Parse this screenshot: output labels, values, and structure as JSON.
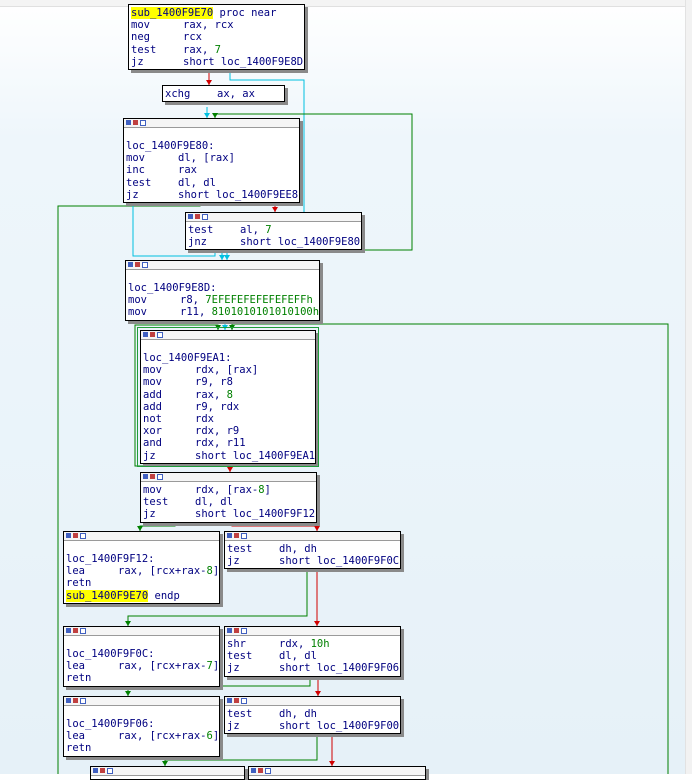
{
  "nodes": [
    {
      "id": "n0",
      "header": false,
      "selected": false,
      "lines": [
        {
          "kind": "label",
          "text": "sub_1400F9E70",
          "suffix": " proc near",
          "highlight": true
        },
        {
          "kind": "ins",
          "m": "mov",
          "o": "rax, rcx"
        },
        {
          "kind": "ins",
          "m": "neg",
          "o": "rcx"
        },
        {
          "kind": "ins",
          "m": "test",
          "o": "rax, ",
          "n": "7"
        },
        {
          "kind": "ins",
          "m": "jz",
          "o": "short loc_1400F9E8D"
        }
      ]
    },
    {
      "id": "n1",
      "header": false,
      "selected": false,
      "lines": [
        {
          "kind": "ins",
          "m": "xchg",
          "o": "ax, ax"
        }
      ]
    },
    {
      "id": "n2",
      "header": true,
      "selected": false,
      "lines": [
        {
          "kind": "blank"
        },
        {
          "kind": "label",
          "text": "loc_1400F9E80:"
        },
        {
          "kind": "ins",
          "m": "mov",
          "o": "dl, [rax]"
        },
        {
          "kind": "ins",
          "m": "inc",
          "o": "rax"
        },
        {
          "kind": "ins",
          "m": "test",
          "o": "dl, dl"
        },
        {
          "kind": "ins",
          "m": "jz",
          "o": "short loc_1400F9EE8"
        }
      ]
    },
    {
      "id": "n3",
      "header": true,
      "selected": false,
      "lines": [
        {
          "kind": "ins",
          "m": "test",
          "o": "al, ",
          "n": "7"
        },
        {
          "kind": "ins",
          "m": "jnz",
          "o": "short loc_1400F9E80"
        }
      ]
    },
    {
      "id": "n4",
      "header": true,
      "selected": false,
      "lines": [
        {
          "kind": "blank"
        },
        {
          "kind": "label",
          "text": "loc_1400F9E8D:"
        },
        {
          "kind": "ins",
          "m": "mov",
          "o": "r8, ",
          "n": "7EFEFEFEFEFEFEFFh"
        },
        {
          "kind": "ins",
          "m": "mov",
          "o": "r11, ",
          "n": "8101010101010100h"
        }
      ]
    },
    {
      "id": "n5",
      "header": true,
      "selected": true,
      "lines": [
        {
          "kind": "blank"
        },
        {
          "kind": "label",
          "text": "loc_1400F9EA1:"
        },
        {
          "kind": "ins",
          "m": "mov",
          "o": "rdx, [rax]"
        },
        {
          "kind": "ins",
          "m": "mov",
          "o": "r9, r8"
        },
        {
          "kind": "ins",
          "m": "add",
          "o": "rax, ",
          "n": "8"
        },
        {
          "kind": "ins",
          "m": "add",
          "o": "r9, rdx"
        },
        {
          "kind": "ins",
          "m": "not",
          "o": "rdx"
        },
        {
          "kind": "ins",
          "m": "xor",
          "o": "rdx, r9"
        },
        {
          "kind": "ins",
          "m": "and",
          "o": "rdx, r11"
        },
        {
          "kind": "ins",
          "m": "jz",
          "o": "short loc_1400F9EA1"
        }
      ]
    },
    {
      "id": "n6",
      "header": true,
      "selected": false,
      "lines": [
        {
          "kind": "ins",
          "m": "mov",
          "o": "rdx, [rax-",
          "n": "8",
          "o2": "]"
        },
        {
          "kind": "ins",
          "m": "test",
          "o": "dl, dl"
        },
        {
          "kind": "ins",
          "m": "jz",
          "o": "short loc_1400F9F12"
        }
      ]
    },
    {
      "id": "n7",
      "header": true,
      "selected": false,
      "lines": [
        {
          "kind": "blank"
        },
        {
          "kind": "label",
          "text": "loc_1400F9F12:"
        },
        {
          "kind": "ins",
          "m": "lea",
          "o": "rax, [rcx+rax-",
          "n": "8",
          "o2": "]"
        },
        {
          "kind": "ins",
          "m": "retn",
          "o": ""
        },
        {
          "kind": "label",
          "text": "sub_1400F9E70",
          "suffix": " endp",
          "highlight": true
        }
      ]
    },
    {
      "id": "n8",
      "header": true,
      "selected": false,
      "lines": [
        {
          "kind": "ins",
          "m": "test",
          "o": "dh, dh"
        },
        {
          "kind": "ins",
          "m": "jz",
          "o": "short loc_1400F9F0C"
        }
      ]
    },
    {
      "id": "n9",
      "header": true,
      "selected": false,
      "lines": [
        {
          "kind": "blank"
        },
        {
          "kind": "label",
          "text": "loc_1400F9F0C:"
        },
        {
          "kind": "ins",
          "m": "lea",
          "o": "rax, [rcx+rax-",
          "n": "7",
          "o2": "]"
        },
        {
          "kind": "ins",
          "m": "retn",
          "o": ""
        }
      ]
    },
    {
      "id": "n10",
      "header": true,
      "selected": false,
      "lines": [
        {
          "kind": "ins",
          "m": "shr",
          "o": "rdx, ",
          "n": "10h"
        },
        {
          "kind": "ins",
          "m": "test",
          "o": "dl, dl"
        },
        {
          "kind": "ins",
          "m": "jz",
          "o": "short loc_1400F9F06"
        }
      ]
    },
    {
      "id": "n11",
      "header": true,
      "selected": false,
      "lines": [
        {
          "kind": "blank"
        },
        {
          "kind": "label",
          "text": "loc_1400F9F06:"
        },
        {
          "kind": "ins",
          "m": "lea",
          "o": "rax, [rcx+rax-",
          "n": "6",
          "o2": "]"
        },
        {
          "kind": "ins",
          "m": "retn",
          "o": ""
        }
      ]
    },
    {
      "id": "n12",
      "header": true,
      "selected": false,
      "lines": [
        {
          "kind": "ins",
          "m": "test",
          "o": "dh, dh"
        },
        {
          "kind": "ins",
          "m": "jz",
          "o": "short loc_1400F9F00"
        }
      ]
    },
    {
      "id": "n13",
      "header": true,
      "selected": false,
      "lines": []
    },
    {
      "id": "n14",
      "header": true,
      "selected": false,
      "lines": []
    }
  ],
  "colors": {
    "true_edge": "#008000",
    "false_edge": "#d00000",
    "flow_edge": "#00c0e0",
    "back_edge": "#008000",
    "highlight": "#ffff00",
    "immediate": "#008000"
  }
}
